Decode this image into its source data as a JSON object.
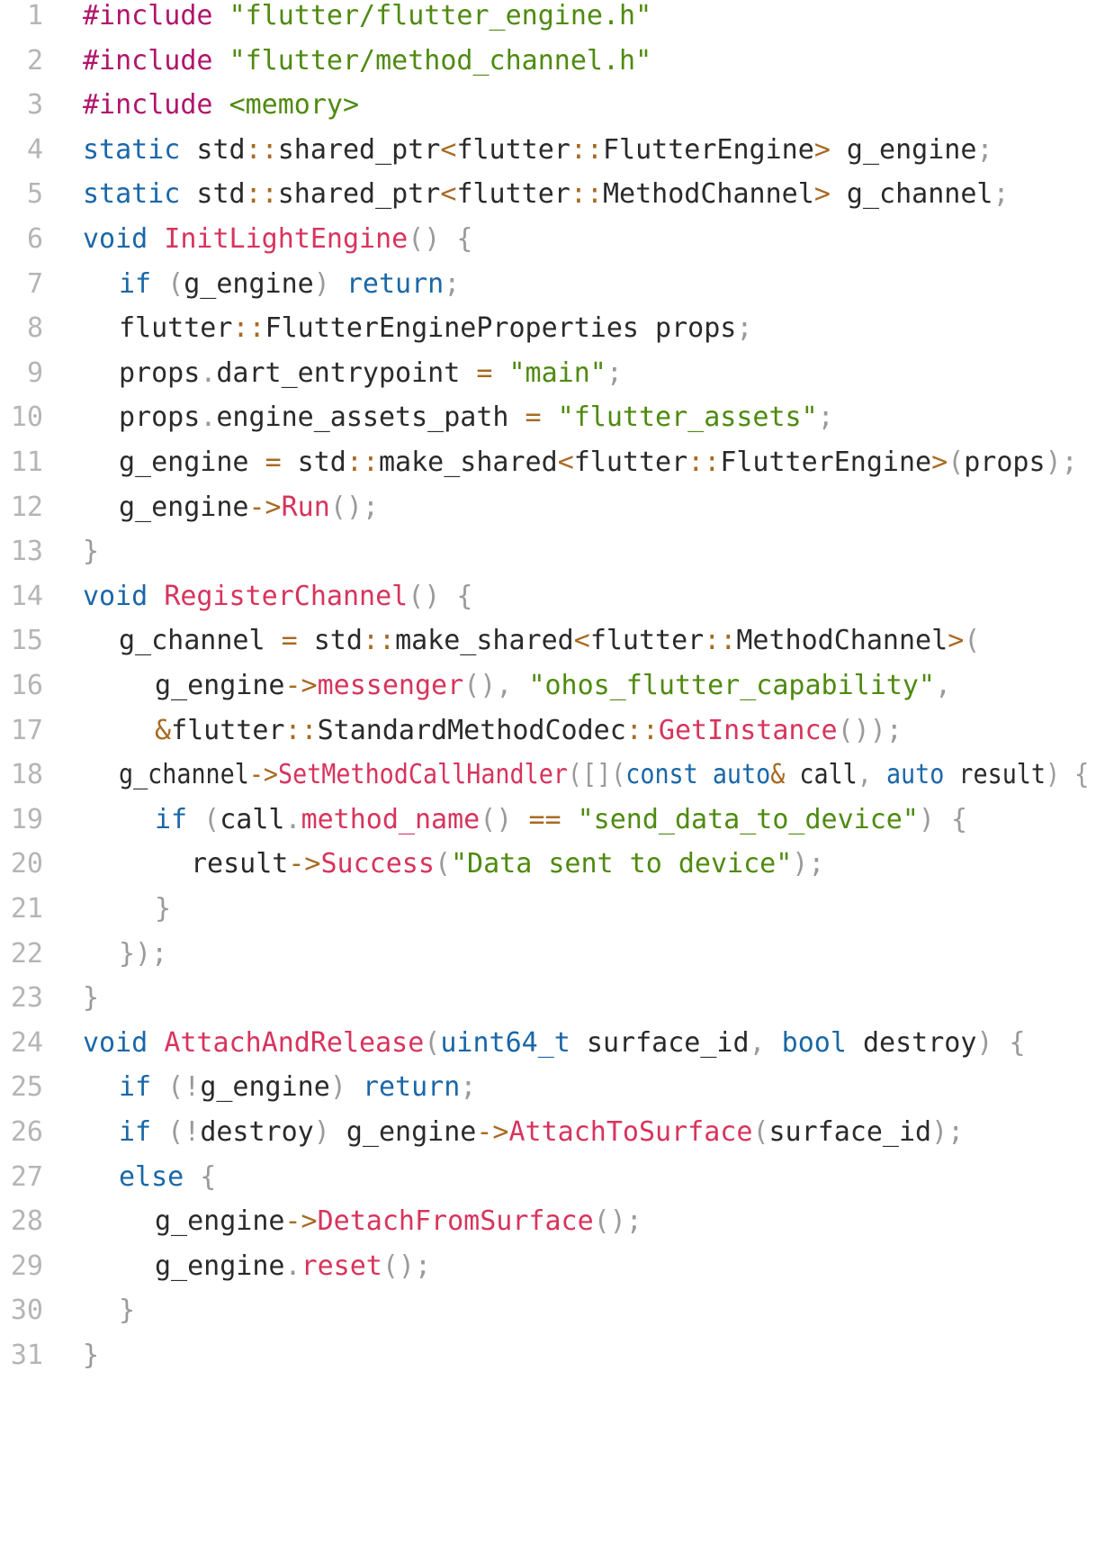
{
  "editor": {
    "colors": {
      "preprocessor": "#b0156b",
      "include_path": "#4f8a10",
      "keyword": "#1a67a8",
      "function": "#d7345d",
      "string": "#4f8a10",
      "operator": "#a86a22",
      "punctuation": "#9a9a9a",
      "plain": "#2a2a2a",
      "line_number": "#b5b5b5"
    },
    "lines": [
      {
        "number": "1",
        "indent": 0,
        "tokens": [
          {
            "t": "#include",
            "c": "preproc"
          },
          {
            "t": " ",
            "c": "plain"
          },
          {
            "t": "\"flutter/flutter_engine.h\"",
            "c": "include"
          }
        ]
      },
      {
        "number": "2",
        "indent": 0,
        "tokens": [
          {
            "t": "#include",
            "c": "preproc"
          },
          {
            "t": " ",
            "c": "plain"
          },
          {
            "t": "\"flutter/method_channel.h\"",
            "c": "include"
          }
        ]
      },
      {
        "number": "3",
        "indent": 0,
        "tokens": [
          {
            "t": "#include",
            "c": "preproc"
          },
          {
            "t": " ",
            "c": "plain"
          },
          {
            "t": "<memory>",
            "c": "include"
          }
        ]
      },
      {
        "number": "4",
        "indent": 0,
        "tokens": [
          {
            "t": "static",
            "c": "keyword"
          },
          {
            "t": " std",
            "c": "plain"
          },
          {
            "t": "::",
            "c": "op"
          },
          {
            "t": "shared_ptr",
            "c": "plain"
          },
          {
            "t": "<",
            "c": "op"
          },
          {
            "t": "flutter",
            "c": "plain"
          },
          {
            "t": "::",
            "c": "op"
          },
          {
            "t": "FlutterEngine",
            "c": "plain"
          },
          {
            "t": ">",
            "c": "op"
          },
          {
            "t": " g_engine",
            "c": "plain"
          },
          {
            "t": ";",
            "c": "punct"
          }
        ]
      },
      {
        "number": "5",
        "indent": 0,
        "tokens": [
          {
            "t": "static",
            "c": "keyword"
          },
          {
            "t": " std",
            "c": "plain"
          },
          {
            "t": "::",
            "c": "op"
          },
          {
            "t": "shared_ptr",
            "c": "plain"
          },
          {
            "t": "<",
            "c": "op"
          },
          {
            "t": "flutter",
            "c": "plain"
          },
          {
            "t": "::",
            "c": "op"
          },
          {
            "t": "MethodChannel",
            "c": "plain"
          },
          {
            "t": ">",
            "c": "op"
          },
          {
            "t": " g_channel",
            "c": "plain"
          },
          {
            "t": ";",
            "c": "punct"
          }
        ]
      },
      {
        "number": "6",
        "indent": 0,
        "tokens": [
          {
            "t": "void",
            "c": "keyword"
          },
          {
            "t": " ",
            "c": "plain"
          },
          {
            "t": "InitLightEngine",
            "c": "func"
          },
          {
            "t": "()",
            "c": "punct"
          },
          {
            "t": " {",
            "c": "punct"
          }
        ]
      },
      {
        "number": "7",
        "indent": 1,
        "tokens": [
          {
            "t": "if",
            "c": "keyword"
          },
          {
            "t": " (",
            "c": "punct"
          },
          {
            "t": "g_engine",
            "c": "plain"
          },
          {
            "t": ")",
            "c": "punct"
          },
          {
            "t": " ",
            "c": "plain"
          },
          {
            "t": "return",
            "c": "keyword"
          },
          {
            "t": ";",
            "c": "punct"
          }
        ]
      },
      {
        "number": "8",
        "indent": 1,
        "tokens": [
          {
            "t": "flutter",
            "c": "plain"
          },
          {
            "t": "::",
            "c": "op"
          },
          {
            "t": "FlutterEngineProperties props",
            "c": "plain"
          },
          {
            "t": ";",
            "c": "punct"
          }
        ]
      },
      {
        "number": "9",
        "indent": 1,
        "tokens": [
          {
            "t": "props",
            "c": "plain"
          },
          {
            "t": ".",
            "c": "punct"
          },
          {
            "t": "dart_entrypoint ",
            "c": "plain"
          },
          {
            "t": "=",
            "c": "op"
          },
          {
            "t": " ",
            "c": "plain"
          },
          {
            "t": "\"main\"",
            "c": "string"
          },
          {
            "t": ";",
            "c": "punct"
          }
        ]
      },
      {
        "number": "10",
        "indent": 1,
        "tokens": [
          {
            "t": "props",
            "c": "plain"
          },
          {
            "t": ".",
            "c": "punct"
          },
          {
            "t": "engine_assets_path ",
            "c": "plain"
          },
          {
            "t": "=",
            "c": "op"
          },
          {
            "t": " ",
            "c": "plain"
          },
          {
            "t": "\"flutter_assets\"",
            "c": "string"
          },
          {
            "t": ";",
            "c": "punct"
          }
        ]
      },
      {
        "number": "11",
        "indent": 1,
        "tokens": [
          {
            "t": "g_engine ",
            "c": "plain"
          },
          {
            "t": "=",
            "c": "op"
          },
          {
            "t": " std",
            "c": "plain"
          },
          {
            "t": "::",
            "c": "op"
          },
          {
            "t": "make_shared",
            "c": "plain"
          },
          {
            "t": "<",
            "c": "op"
          },
          {
            "t": "flutter",
            "c": "plain"
          },
          {
            "t": "::",
            "c": "op"
          },
          {
            "t": "FlutterEngine",
            "c": "plain"
          },
          {
            "t": ">",
            "c": "op"
          },
          {
            "t": "(",
            "c": "punct"
          },
          {
            "t": "props",
            "c": "plain"
          },
          {
            "t": ");",
            "c": "punct"
          }
        ]
      },
      {
        "number": "12",
        "indent": 1,
        "tokens": [
          {
            "t": "g_engine",
            "c": "plain"
          },
          {
            "t": "->",
            "c": "op"
          },
          {
            "t": "Run",
            "c": "func"
          },
          {
            "t": "();",
            "c": "punct"
          }
        ]
      },
      {
        "number": "13",
        "indent": 0,
        "tokens": [
          {
            "t": "}",
            "c": "punct"
          }
        ]
      },
      {
        "number": "14",
        "indent": 0,
        "tokens": [
          {
            "t": "void",
            "c": "keyword"
          },
          {
            "t": " ",
            "c": "plain"
          },
          {
            "t": "RegisterChannel",
            "c": "func"
          },
          {
            "t": "()",
            "c": "punct"
          },
          {
            "t": " {",
            "c": "punct"
          }
        ]
      },
      {
        "number": "15",
        "indent": 1,
        "tokens": [
          {
            "t": "g_channel ",
            "c": "plain"
          },
          {
            "t": "=",
            "c": "op"
          },
          {
            "t": " std",
            "c": "plain"
          },
          {
            "t": "::",
            "c": "op"
          },
          {
            "t": "make_shared",
            "c": "plain"
          },
          {
            "t": "<",
            "c": "op"
          },
          {
            "t": "flutter",
            "c": "plain"
          },
          {
            "t": "::",
            "c": "op"
          },
          {
            "t": "MethodChannel",
            "c": "plain"
          },
          {
            "t": ">",
            "c": "op"
          },
          {
            "t": "(",
            "c": "punct"
          }
        ]
      },
      {
        "number": "16",
        "indent": 2,
        "tokens": [
          {
            "t": "g_engine",
            "c": "plain"
          },
          {
            "t": "->",
            "c": "op"
          },
          {
            "t": "messenger",
            "c": "func"
          },
          {
            "t": "(),",
            "c": "punct"
          },
          {
            "t": " ",
            "c": "plain"
          },
          {
            "t": "\"ohos_flutter_capability\"",
            "c": "string"
          },
          {
            "t": ",",
            "c": "punct"
          }
        ]
      },
      {
        "number": "17",
        "indent": 2,
        "tokens": [
          {
            "t": "&",
            "c": "op"
          },
          {
            "t": "flutter",
            "c": "plain"
          },
          {
            "t": "::",
            "c": "op"
          },
          {
            "t": "StandardMethodCodec",
            "c": "plain"
          },
          {
            "t": "::",
            "c": "op"
          },
          {
            "t": "GetInstance",
            "c": "func"
          },
          {
            "t": "());",
            "c": "punct"
          }
        ]
      },
      {
        "number": "18",
        "indent": 1,
        "tokens": [
          {
            "t": "g_channel",
            "c": "plain"
          },
          {
            "t": "->",
            "c": "op"
          },
          {
            "t": "SetMethodCallHandler",
            "c": "func"
          },
          {
            "t": "([](",
            "c": "punct"
          },
          {
            "t": "const",
            "c": "keyword"
          },
          {
            "t": " ",
            "c": "plain"
          },
          {
            "t": "auto",
            "c": "keyword"
          },
          {
            "t": "&",
            "c": "op"
          },
          {
            "t": " call",
            "c": "plain"
          },
          {
            "t": ",",
            "c": "punct"
          },
          {
            "t": " ",
            "c": "plain"
          },
          {
            "t": "auto",
            "c": "keyword"
          },
          {
            "t": " result",
            "c": "plain"
          },
          {
            "t": ")",
            "c": "punct"
          },
          {
            "t": " {",
            "c": "punct"
          }
        ]
      },
      {
        "number": "19",
        "indent": 2,
        "tokens": [
          {
            "t": "if",
            "c": "keyword"
          },
          {
            "t": " (",
            "c": "punct"
          },
          {
            "t": "call",
            "c": "plain"
          },
          {
            "t": ".",
            "c": "punct"
          },
          {
            "t": "method_name",
            "c": "func"
          },
          {
            "t": "()",
            "c": "punct"
          },
          {
            "t": " ",
            "c": "plain"
          },
          {
            "t": "==",
            "c": "op"
          },
          {
            "t": " ",
            "c": "plain"
          },
          {
            "t": "\"send_data_to_device\"",
            "c": "string"
          },
          {
            "t": ")",
            "c": "punct"
          },
          {
            "t": " {",
            "c": "punct"
          }
        ]
      },
      {
        "number": "20",
        "indent": 3,
        "tokens": [
          {
            "t": "result",
            "c": "plain"
          },
          {
            "t": "->",
            "c": "op"
          },
          {
            "t": "Success",
            "c": "func"
          },
          {
            "t": "(",
            "c": "punct"
          },
          {
            "t": "\"Data sent to device\"",
            "c": "string"
          },
          {
            "t": ");",
            "c": "punct"
          }
        ]
      },
      {
        "number": "21",
        "indent": 2,
        "tokens": [
          {
            "t": "}",
            "c": "punct"
          }
        ]
      },
      {
        "number": "22",
        "indent": 1,
        "tokens": [
          {
            "t": "});",
            "c": "punct"
          }
        ]
      },
      {
        "number": "23",
        "indent": 0,
        "tokens": [
          {
            "t": "}",
            "c": "punct"
          }
        ]
      },
      {
        "number": "24",
        "indent": 0,
        "tokens": [
          {
            "t": "void",
            "c": "keyword"
          },
          {
            "t": " ",
            "c": "plain"
          },
          {
            "t": "AttachAndRelease",
            "c": "func"
          },
          {
            "t": "(",
            "c": "punct"
          },
          {
            "t": "uint64_t",
            "c": "keyword"
          },
          {
            "t": " surface_id",
            "c": "plain"
          },
          {
            "t": ",",
            "c": "punct"
          },
          {
            "t": " ",
            "c": "plain"
          },
          {
            "t": "bool",
            "c": "keyword"
          },
          {
            "t": " destroy",
            "c": "plain"
          },
          {
            "t": ")",
            "c": "punct"
          },
          {
            "t": " {",
            "c": "punct"
          }
        ]
      },
      {
        "number": "25",
        "indent": 1,
        "tokens": [
          {
            "t": "if",
            "c": "keyword"
          },
          {
            "t": " (!",
            "c": "punct"
          },
          {
            "t": "g_engine",
            "c": "plain"
          },
          {
            "t": ")",
            "c": "punct"
          },
          {
            "t": " ",
            "c": "plain"
          },
          {
            "t": "return",
            "c": "keyword"
          },
          {
            "t": ";",
            "c": "punct"
          }
        ]
      },
      {
        "number": "26",
        "indent": 1,
        "tokens": [
          {
            "t": "if",
            "c": "keyword"
          },
          {
            "t": " (!",
            "c": "punct"
          },
          {
            "t": "destroy",
            "c": "plain"
          },
          {
            "t": ")",
            "c": "punct"
          },
          {
            "t": " g_engine",
            "c": "plain"
          },
          {
            "t": "->",
            "c": "op"
          },
          {
            "t": "AttachToSurface",
            "c": "func"
          },
          {
            "t": "(",
            "c": "punct"
          },
          {
            "t": "surface_id",
            "c": "plain"
          },
          {
            "t": ");",
            "c": "punct"
          }
        ]
      },
      {
        "number": "27",
        "indent": 1,
        "tokens": [
          {
            "t": "else",
            "c": "keyword"
          },
          {
            "t": " {",
            "c": "punct"
          }
        ]
      },
      {
        "number": "28",
        "indent": 2,
        "tokens": [
          {
            "t": "g_engine",
            "c": "plain"
          },
          {
            "t": "->",
            "c": "op"
          },
          {
            "t": "DetachFromSurface",
            "c": "func"
          },
          {
            "t": "();",
            "c": "punct"
          }
        ]
      },
      {
        "number": "29",
        "indent": 2,
        "tokens": [
          {
            "t": "g_engine",
            "c": "plain"
          },
          {
            "t": ".",
            "c": "punct"
          },
          {
            "t": "reset",
            "c": "func"
          },
          {
            "t": "();",
            "c": "punct"
          }
        ]
      },
      {
        "number": "30",
        "indent": 1,
        "tokens": [
          {
            "t": "}",
            "c": "punct"
          }
        ]
      },
      {
        "number": "31",
        "indent": 0,
        "tokens": [
          {
            "t": "}",
            "c": "punct"
          }
        ]
      }
    ]
  }
}
